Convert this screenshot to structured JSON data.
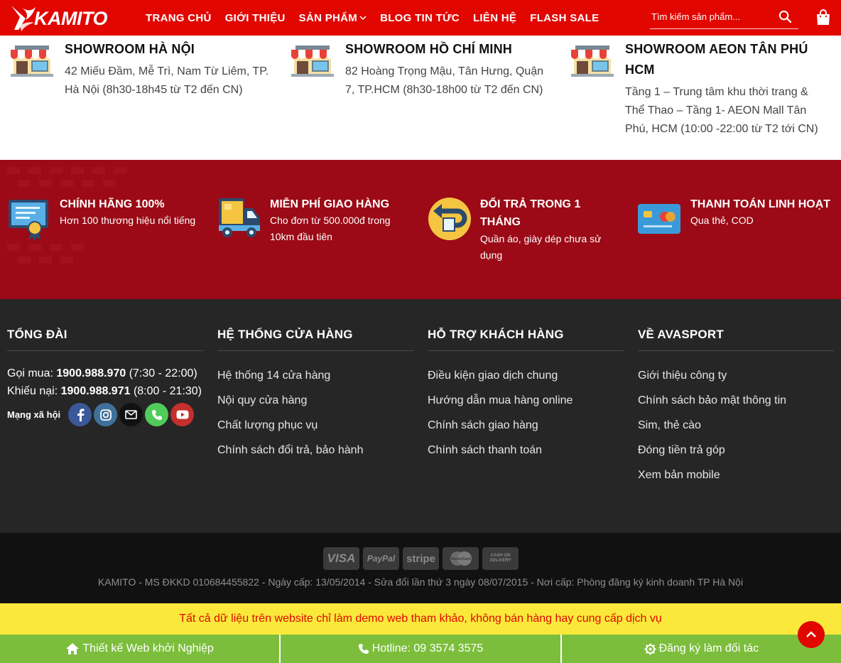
{
  "header": {
    "logo_text": "KAMITO",
    "nav": [
      "TRANG CHỦ",
      "GIỚI THIỆU",
      "SẢN PHẨM",
      "BLOG TIN TỨC",
      "LIÊN HỆ",
      "FLASH SALE"
    ],
    "search_placeholder": "Tìm kiếm sản phẩm..."
  },
  "showrooms": [
    {
      "title": "SHOWROOM HÀ NỘI",
      "address": "42 Miếu Đầm, Mễ Trì, Nam Từ Liêm, TP. Hà Nội (8h30-18h45 từ T2 đến CN)"
    },
    {
      "title": "SHOWROOM HỒ CHÍ MINH",
      "address": "82 Hoàng Trọng Mậu, Tân Hưng, Quận 7, TP.HCM (8h30-18h00 từ T2 đến CN)"
    },
    {
      "title": "SHOWROOM AEON TÂN PHÚ HCM",
      "address": "Tầng 1 – Trung tâm khu thời trang & Thể Thao – Tầng 1- AEON Mall Tân Phú, HCM (10:00 -22:00 từ T2 tới CN)"
    }
  ],
  "benefits": [
    {
      "title": "CHÍNH HÃNG 100%",
      "desc": "Hơn 100 thương hiệu nổi tiếng"
    },
    {
      "title": "MIỄN PHÍ GIAO HÀNG",
      "desc": "Cho đơn từ 500.000đ trong 10km đầu tiên"
    },
    {
      "title": "ĐỔI TRẢ TRONG 1 THÁNG",
      "desc": "Quần áo, giày dép chưa sử dụng"
    },
    {
      "title": "THANH TOÁN LINH HOẠT",
      "desc": "Qua thẻ, COD"
    }
  ],
  "footer": {
    "hotline": {
      "title": "TỔNG ĐÀI",
      "buy_label": "Gọi mua:",
      "buy_number": "1900.988.970",
      "buy_hours": "(7:30 - 22:00)",
      "complain_label": "Khiếu nại:",
      "complain_number": "1900.988.971",
      "complain_hours": "(8:00 - 21:30)",
      "social_label": "Mạng xã hội"
    },
    "stores": {
      "title": "HỆ THỐNG CỬA HÀNG",
      "links": [
        "Hệ thống 14 cửa hàng",
        "Nội quy cửa hàng",
        "Chất lượng phục vụ",
        "Chính sách đổi trả, bảo hành"
      ]
    },
    "support": {
      "title": "HỖ TRỢ KHÁCH HÀNG",
      "links": [
        "Điều kiện giao dịch chung",
        "Hướng dẫn mua hàng online",
        "Chính sách giao hàng",
        "Chính sách thanh toán"
      ]
    },
    "about": {
      "title": "VỀ AVASPORT",
      "links": [
        "Giới thiệu công ty",
        "Chính sách bảo mật thông tin",
        "Sim, thẻ cào",
        "Đóng tiền trả góp",
        "Xem bản mobile"
      ]
    }
  },
  "payments": [
    "VISA",
    "PayPal",
    "stripe",
    "MasterCard",
    "CASH ON DELIVERY"
  ],
  "legal": "KAMITO - MS ĐKKD 010684455822 - Ngày cấp: 13/05/2014 - Sửa đổi lần thứ 3 ngày 08/07/2015 - Nơi cấp: Phòng đăng ký kinh doanh TP Hà Nội",
  "notice": "Tất cả dữ liệu trên website chỉ làm demo web tham khảo, không bán hàng hay cung cấp dịch vụ",
  "actions": [
    "Thiết kế Web khởi Nghiệp",
    "Hotline: 09 3574 3575",
    "Đăng ký làm đối tác"
  ],
  "colors": {
    "brand_red": "#e10600",
    "benefit_red": "#9b0a16",
    "footer_dark": "#262626",
    "notice_yellow": "#fae93b",
    "action_green": "#7cbe3c"
  }
}
